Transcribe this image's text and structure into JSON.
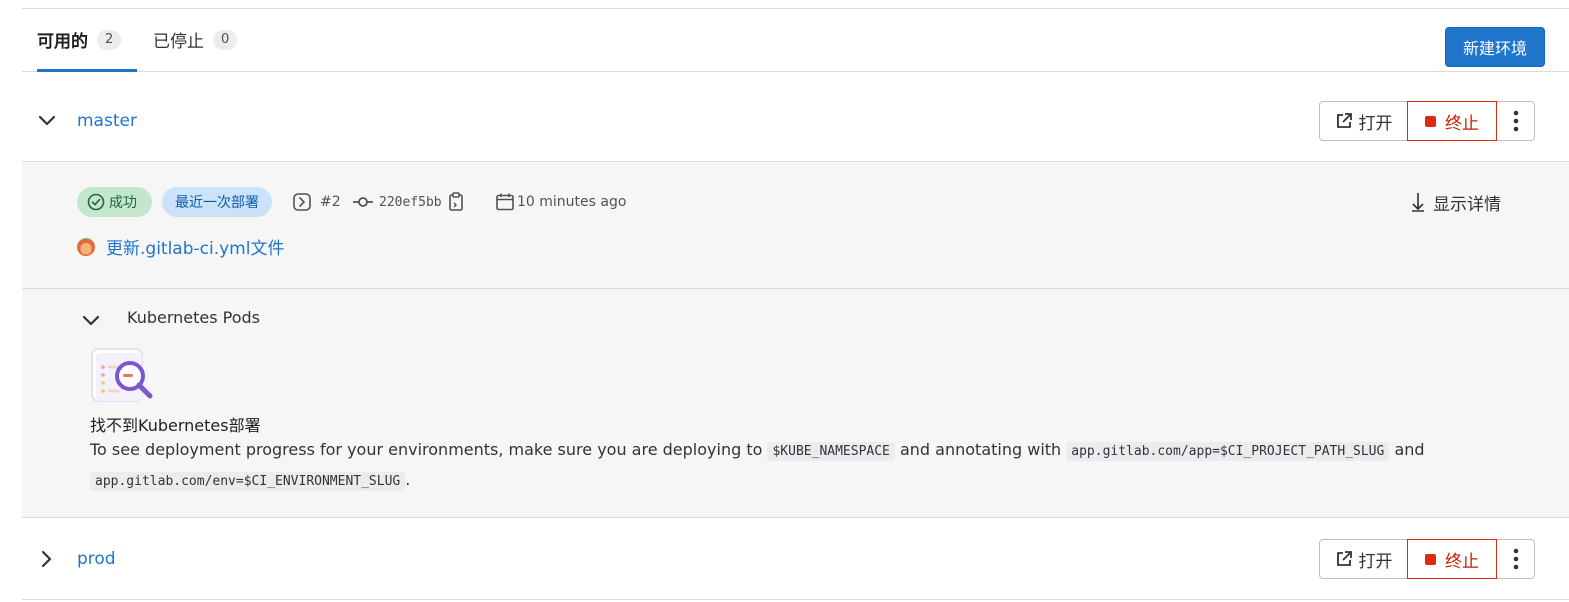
{
  "tabs": [
    {
      "label": "可用的",
      "count": "2"
    },
    {
      "label": "已停止",
      "count": "0"
    }
  ],
  "new_env_button": "新建环境",
  "environments": [
    {
      "name": "master",
      "open_label": "打开",
      "stop_label": "终止",
      "expanded": true
    },
    {
      "name": "prod",
      "open_label": "打开",
      "stop_label": "终止",
      "expanded": false
    }
  ],
  "deployment": {
    "status": "成功",
    "latest_badge": "最近一次部署",
    "deploy_id": "#2",
    "commit_sha": "220ef5bb",
    "time": "10 minutes ago",
    "show_details": "显示详情",
    "commit_title": "更新.gitlab-ci.yml文件"
  },
  "k8s": {
    "title": "Kubernetes Pods",
    "empty_title": "找不到Kubernetes部署",
    "desc_1": "To see deployment progress for your environments, make sure you are deploying to",
    "code_namespace": "$KUBE_NAMESPACE",
    "desc_2": "and annotating with",
    "code_app": "app.gitlab.com/app=$CI_PROJECT_PATH_SLUG",
    "desc_3": "and",
    "code_env": "app.gitlab.com/env=$CI_ENVIRONMENT_SLUG",
    "desc_4": "."
  },
  "colors": {
    "primary": "#1f75cb",
    "danger": "#dd2b0e",
    "success_bg": "#c3e6cd",
    "info_bg": "#cbe2f9"
  },
  "icons": [
    "chevron-down-icon",
    "chevron-right-icon",
    "external-link-icon",
    "stop-icon",
    "kebab-icon",
    "check-circle-icon",
    "deploy-icon",
    "commit-icon",
    "copy-icon",
    "calendar-icon",
    "expand-down-icon",
    "empty-search-illustration"
  ]
}
